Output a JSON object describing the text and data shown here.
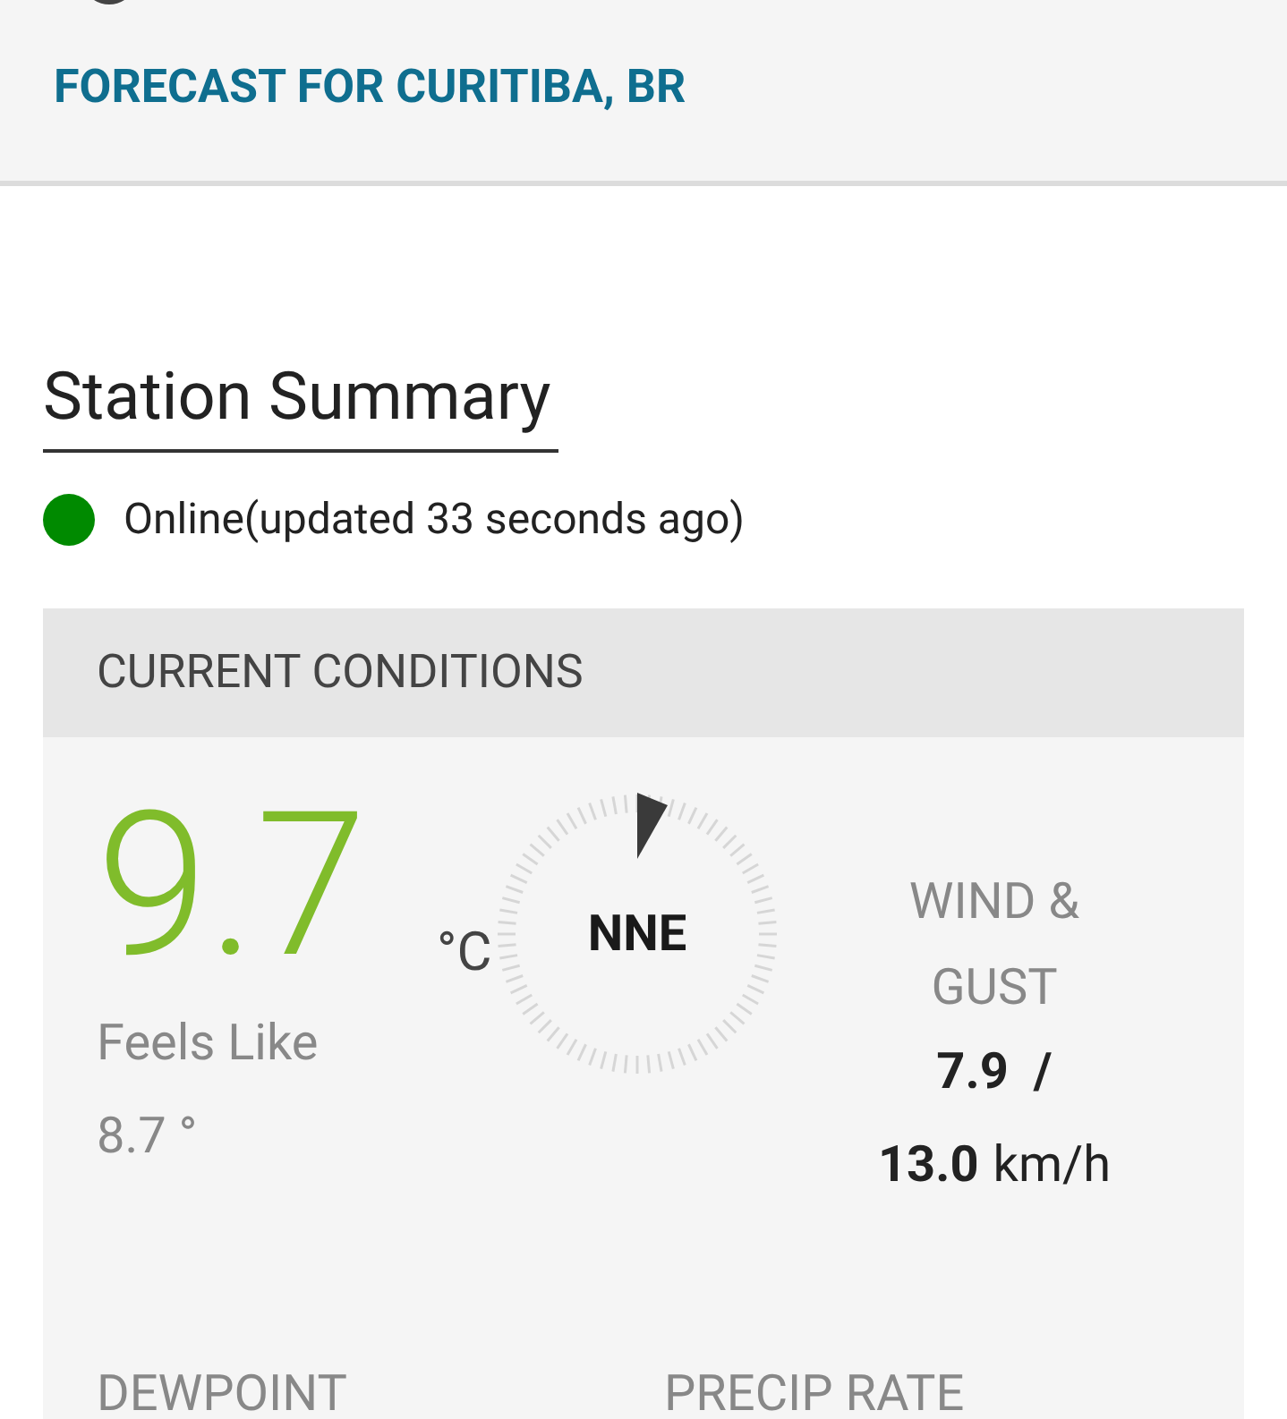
{
  "header": {
    "title": "FORECAST FOR CURITIBA, BR"
  },
  "station_summary": {
    "heading": "Station Summary",
    "status": {
      "text": "Online(updated 33 seconds ago)",
      "color": "#008a00"
    }
  },
  "current_conditions": {
    "heading": "CURRENT CONDITIONS",
    "temperature": "9.7",
    "unit": "°C",
    "feels_like_label": "Feels Like",
    "feels_like_value": "8.7 °",
    "wind_direction": "NNE",
    "wind_label": "WIND & GUST",
    "wind_speed": "7.9",
    "separator": "/",
    "gust_speed": "13.0",
    "wind_unit": "km/h"
  },
  "next_row": [
    "DEWPOINT",
    "PRECIP RATE"
  ]
}
